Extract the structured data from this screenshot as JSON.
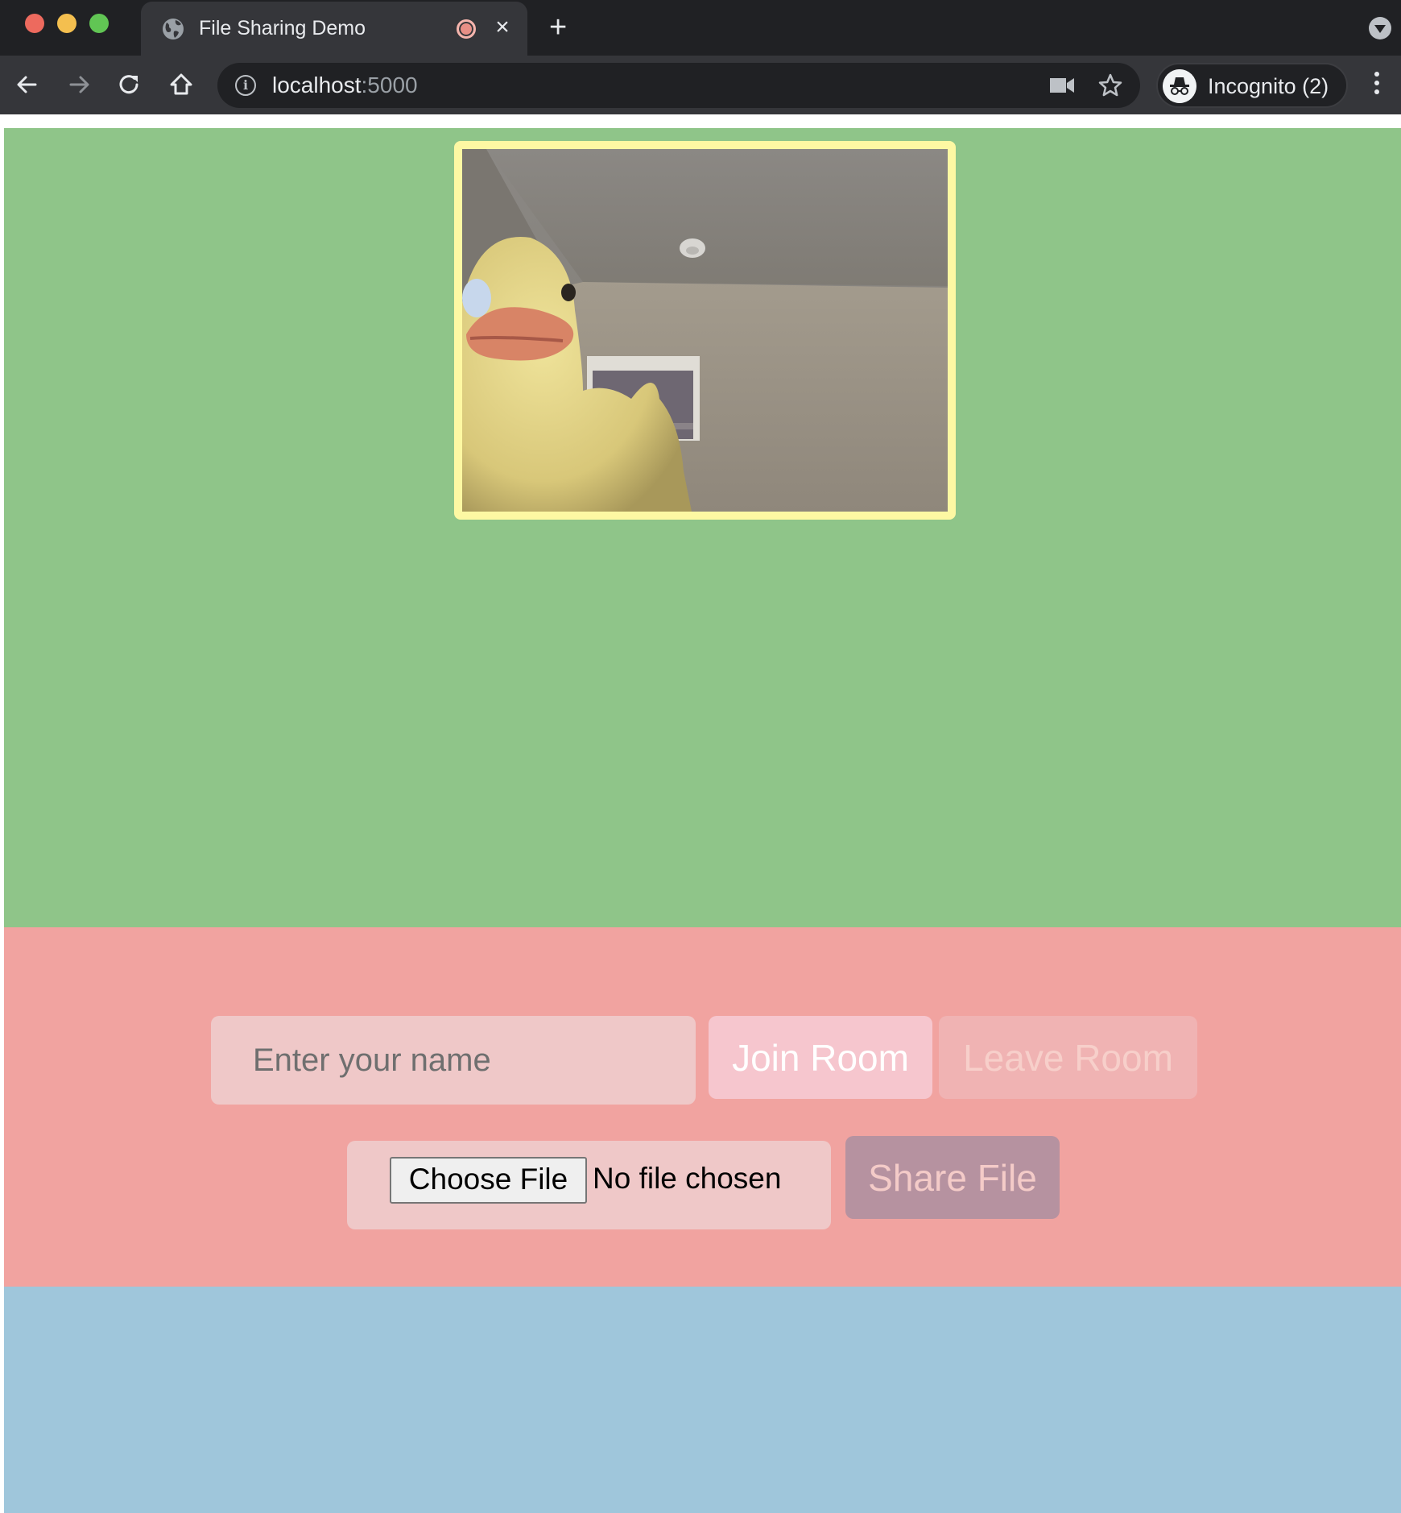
{
  "browser": {
    "tab": {
      "title": "File Sharing Demo",
      "favicon": "globe-icon",
      "recording_indicator": "record-icon",
      "close_label": "×"
    },
    "new_tab_label": "+",
    "nav": {
      "back": "back-arrow-icon",
      "forward": "forward-arrow-icon",
      "reload": "reload-icon",
      "home": "home-icon"
    },
    "address": {
      "host": "localhost",
      "port": ":5000"
    },
    "profile_label": "Incognito (2)"
  },
  "page": {
    "video": {
      "subject": "rubber duck webcam feed"
    },
    "controls": {
      "name_placeholder": "Enter your name",
      "name_value": "",
      "join_label": "Join Room",
      "leave_label": "Leave Room",
      "choose_file_label": "Choose File",
      "file_status": "No file chosen",
      "share_label": "Share File"
    }
  },
  "colors": {
    "video_section_bg": "#8fc589",
    "video_frame_border": "#fdf8a3",
    "controls_section_bg": "#f1a3a0",
    "messages_section_bg": "#9fc6db",
    "share_button_bg": "#b692a0"
  }
}
